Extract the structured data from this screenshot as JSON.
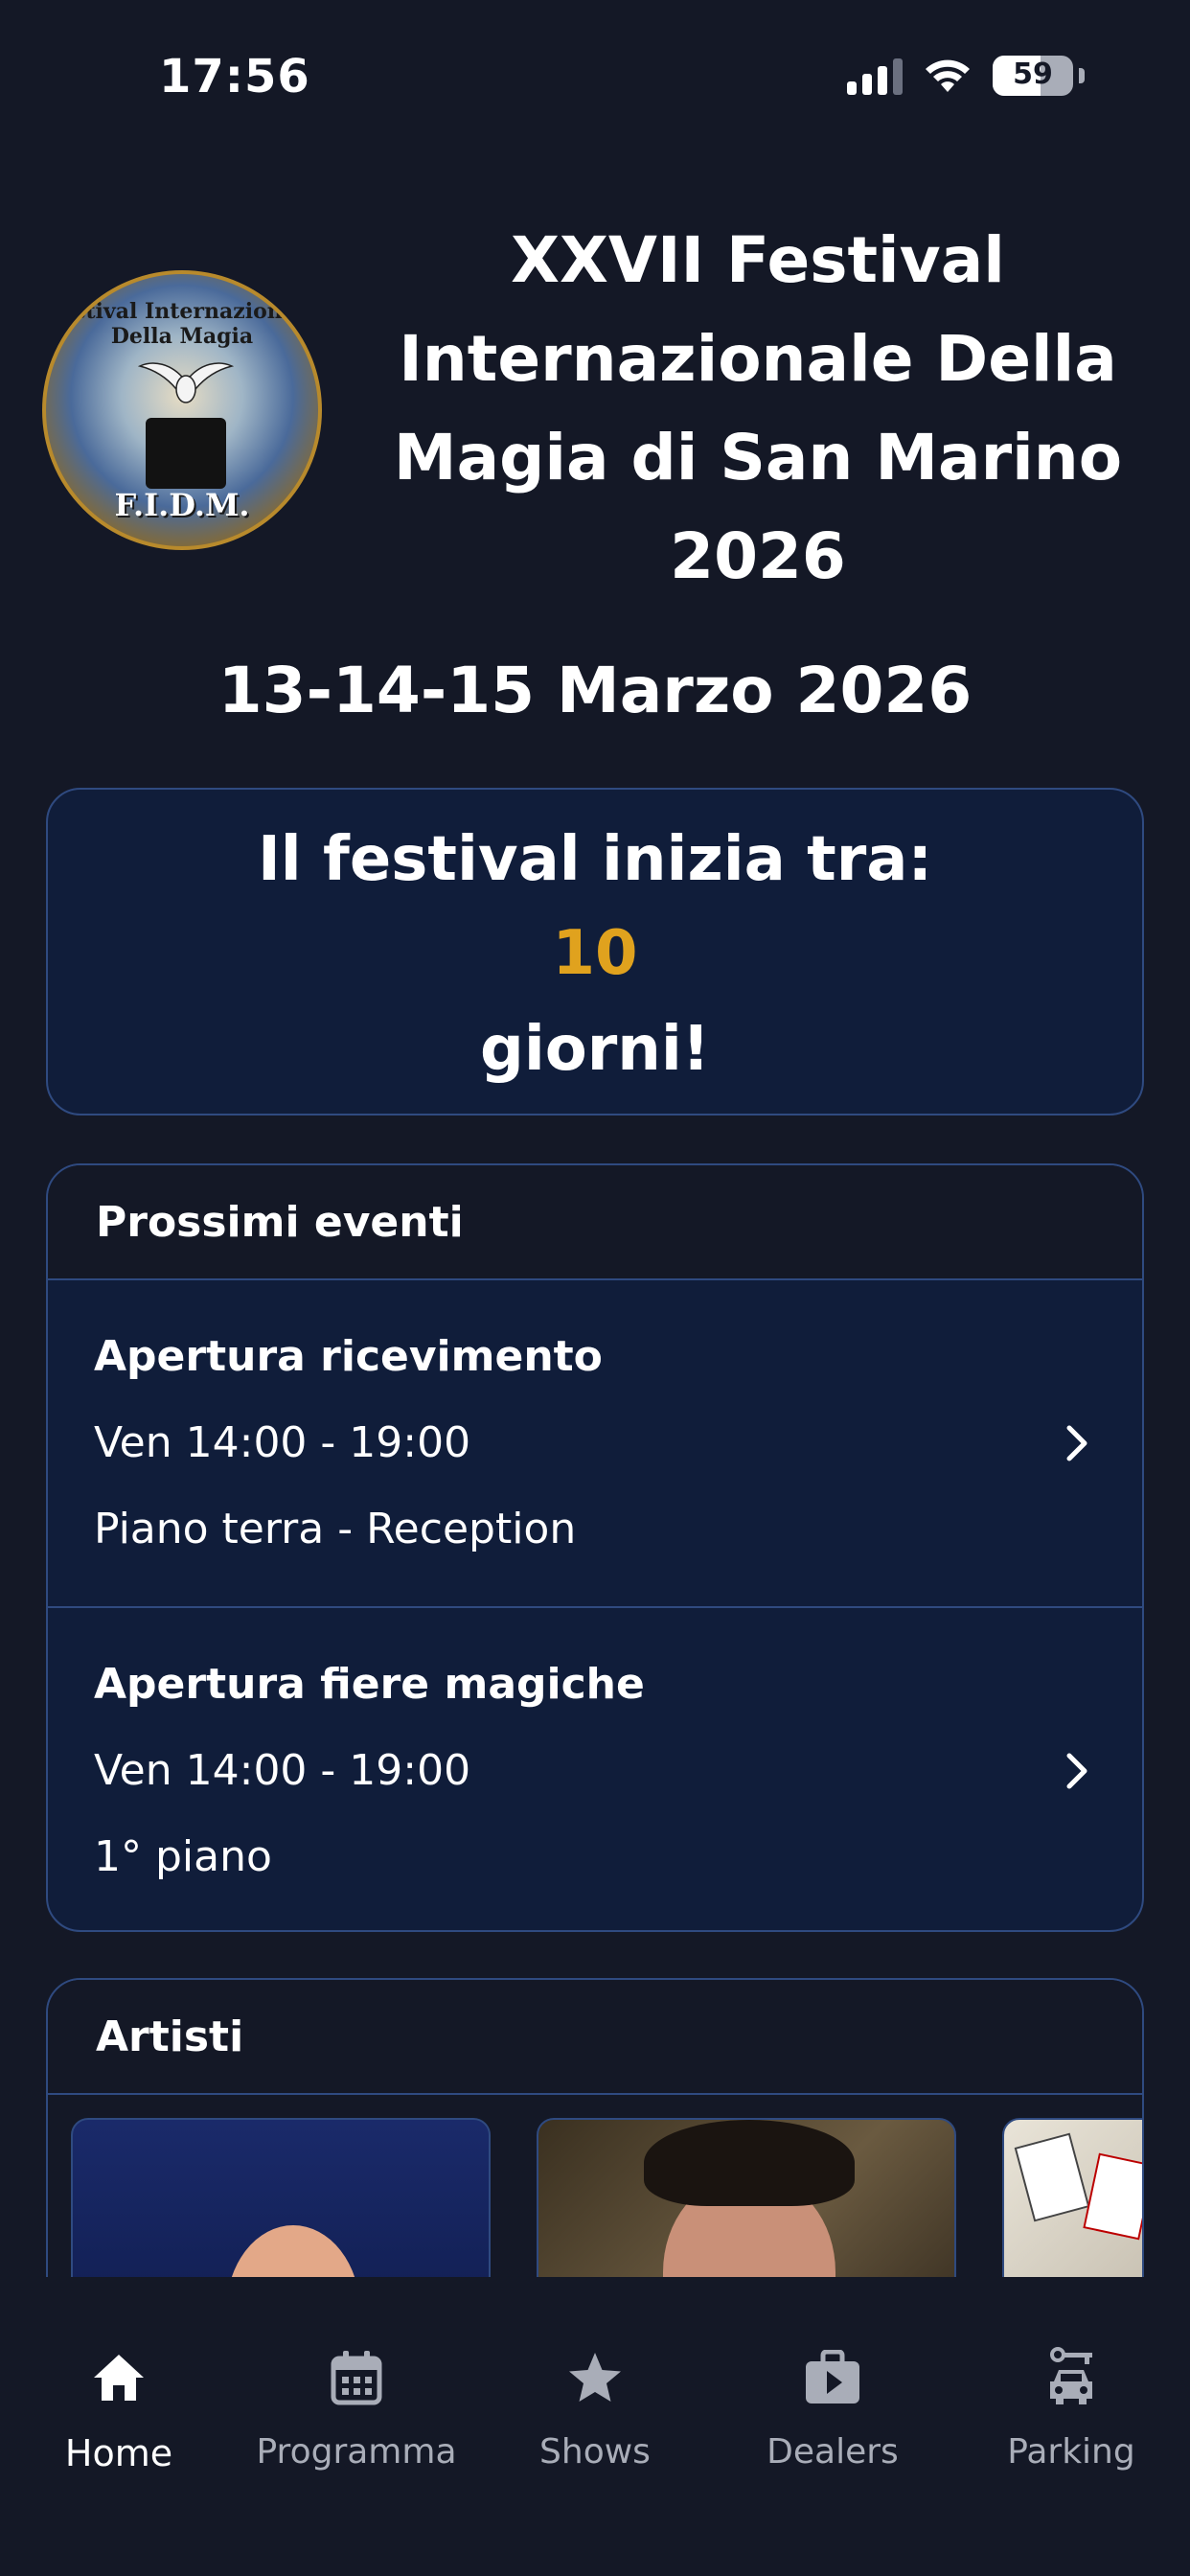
{
  "status_bar": {
    "time": "17:56",
    "battery": "59"
  },
  "header": {
    "logo_ring_text": "Festival Internazionale Della Magia",
    "logo_initials": "F.I.D.M.",
    "title_lines": [
      "XXVII Festival",
      "Internazionale Della",
      "Magia di San Marino",
      "2026"
    ],
    "dates": "13-14-15 Marzo 2026"
  },
  "countdown": {
    "label": "Il festival inizia tra:",
    "days": "10",
    "suffix": "giorni!",
    "accent_color": "#e0a21e"
  },
  "events": {
    "header": "Prossimi eventi",
    "items": [
      {
        "title": "Apertura ricevimento",
        "time": "Ven 14:00 - 19:00",
        "place": "Piano terra - Reception"
      },
      {
        "title": "Apertura fiere magiche",
        "time": "Ven 14:00 - 19:00",
        "place": "1° piano"
      }
    ]
  },
  "artists": {
    "header": "Artisti"
  },
  "tabs": [
    {
      "label": "Home",
      "icon": "home-icon",
      "active": true
    },
    {
      "label": "Programma",
      "icon": "calendar-icon",
      "active": false
    },
    {
      "label": "Shows",
      "icon": "star-icon",
      "active": false
    },
    {
      "label": "Dealers",
      "icon": "briefcase-play-icon",
      "active": false
    },
    {
      "label": "Parking",
      "icon": "car-parking-icon",
      "active": false
    }
  ]
}
